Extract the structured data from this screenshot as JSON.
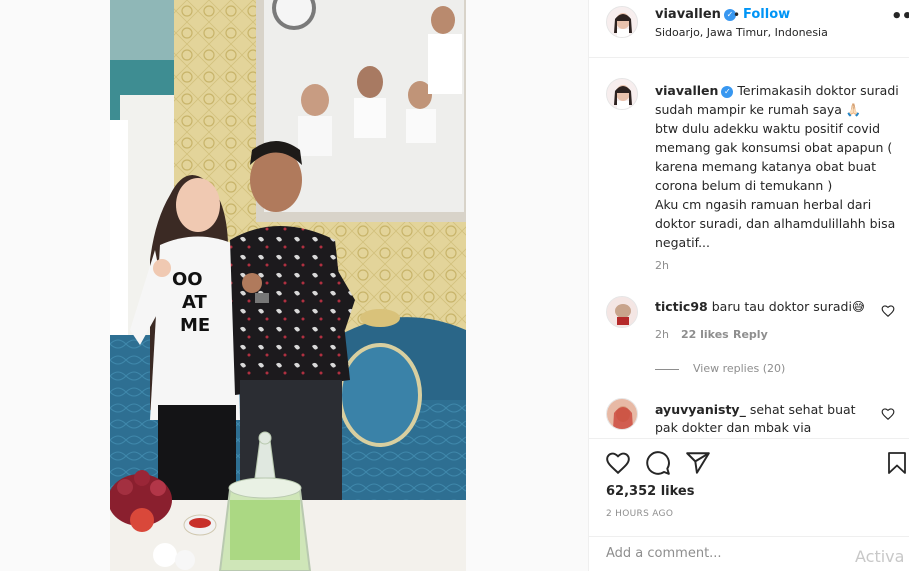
{
  "post": {
    "username": "viavallen",
    "location": "Sidoarjo, Jawa Timur, Indonesia",
    "follow_label": "Follow",
    "dot": "•",
    "more": "•••"
  },
  "caption": {
    "username": "viavallen",
    "text": "Terimakasih doktor suradi\nsudah mampir ke rumah saya 🙏🏻\nbtw dulu adekku waktu positif covid\nmemang gak konsumsi obat apapun (\nkarena memang katanya obat buat\ncorona belum di temukann )\nAku cm ngasih ramuan herbal dari\ndoktor suradi, dan alhamdulillahh bisa\nnegatif...",
    "age": "2h"
  },
  "comments": [
    {
      "username": "tictic98",
      "text": "baru tau doktor suradi😅",
      "age": "2h",
      "likes": "22 likes",
      "reply_label": "Reply",
      "view_replies": "View replies (20)"
    },
    {
      "username": "ayuvyanisty_",
      "text": "sehat sehat buat pak dokter dan mbak via sekeluarga"
    }
  ],
  "stats": {
    "likes": "62,352 likes",
    "time": "2 HOURS AGO"
  },
  "add_comment": {
    "placeholder": "Add a comment..."
  },
  "watermark": "Activa",
  "photo": {
    "shirt_text_1": "OO",
    "shirt_text_2": "AT",
    "shirt_text_3": "ME"
  }
}
